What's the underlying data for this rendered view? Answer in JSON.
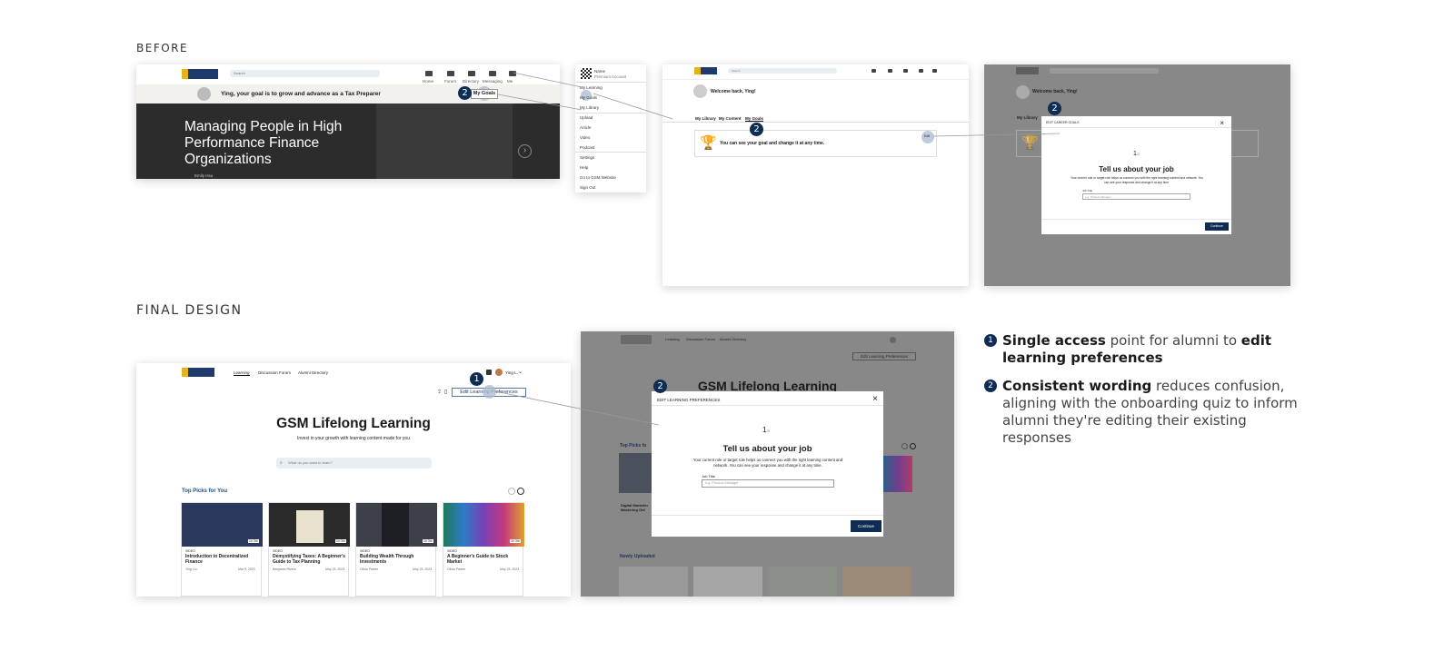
{
  "sections": {
    "before": "BEFORE",
    "final": "FINAL DESIGN"
  },
  "colors": {
    "navy": "#0f2c55",
    "gold": "#e4b21b",
    "gray_overlay": "#7a7a7a"
  },
  "before_home": {
    "search_placeholder": "Search",
    "nav": [
      "Home",
      "Forum",
      "Directory",
      "Messaging",
      "Me"
    ],
    "goal_text": "Ying, your goal is to grow and advance as a Tax Preparer",
    "goal_button": "My Goals",
    "hero_title": "Managing People in High Performance Finance Organizations",
    "hero_author": "Emily Hsu"
  },
  "before_menu": {
    "profile_name": "Name",
    "profile_sub": "Premium Account",
    "items": [
      "My Learning",
      "My Goals",
      "My Library",
      "Upload",
      "Article",
      "Video",
      "Podcast",
      "Settings",
      "Help",
      "Go to GSM Website",
      "Sign Out"
    ]
  },
  "before_goals": {
    "welcome": "Welcome back, Ying!",
    "tabs": [
      "My Library",
      "My Content",
      "My Goals"
    ],
    "goal_msg": "You can see your goal and change it at any time.",
    "edit": "Edit"
  },
  "before_modal": {
    "title": "EDIT CAREER GOALS",
    "step": "1",
    "step_total": "/3",
    "heading": "Tell us about your job",
    "desc": "Your current role or target role helps us connect you with the right learning content and network. You can see your response and change it at any time.",
    "field_label": "Job Title",
    "field_placeholder": "e.g. Product Manager",
    "continue": "Continue"
  },
  "final_home": {
    "nav": [
      "Learning",
      "Discussion Forum",
      "Alumni Directory"
    ],
    "user": "Ying L.",
    "edit_pref": "Edit Learning Preferences",
    "title": "GSM Lifelong Learning",
    "subtitle": "Invest in your growth with learning content made for you",
    "search_placeholder": "What do you want to learn?",
    "top_picks": "Top Picks for You",
    "cards": [
      {
        "type": "VIDEO",
        "title": "Introduction to Decentralized Finance",
        "author": "Ying Liu",
        "date": "Mar 5, 2020",
        "duration": "1h 3m"
      },
      {
        "type": "VIDEO",
        "title": "Demystifying Taxes: A Beginner's Guide to Tax Planning",
        "author": "Benjamin Rivers",
        "date": "May 23, 2023",
        "duration": "1h 3m"
      },
      {
        "type": "VIDEO",
        "title": "Building Wealth Through Investments",
        "author": "Olivia Parker",
        "date": "May 23, 2023",
        "duration": "1h 3m"
      },
      {
        "type": "VIDEO",
        "title": "A Beginner's Guide to Stock Market",
        "author": "Olivia Parker",
        "date": "May 23, 2023",
        "duration": "1h 3m"
      }
    ]
  },
  "final_modal": {
    "nav": [
      "Learning",
      "Discussion Forum",
      "Alumni Directory"
    ],
    "bg_title": "GSM Lifelong Learning",
    "edit_pref": "Edit Learning Preferences",
    "top_picks": "Top Picks fo",
    "newly": "Newly Uploaded",
    "title": "EDIT LEARNING PREFERENCES",
    "step": "1",
    "step_total": "/3",
    "heading": "Tell us about your job",
    "desc": "Your current role or target role helps us connect you with the right learning content and network. You can see your response and change it at any time.",
    "field_label": "Job Title",
    "field_placeholder": "e.g. Product Manager",
    "continue": "Continue",
    "bg_card_title": "Digital Marketin Mastering Onl"
  },
  "markers": {
    "one": "1",
    "two": "2"
  },
  "legend": [
    {
      "num": "1",
      "b1": "Single access",
      "t1": " point for alumni to ",
      "b2": "edit learning preferences",
      "t2": ""
    },
    {
      "num": "2",
      "b1": "Consistent wording",
      "t1": " reduces confusion, aligning with the onboarding quiz to inform alumni they're editing their existing responses",
      "b2": "",
      "t2": ""
    }
  ]
}
